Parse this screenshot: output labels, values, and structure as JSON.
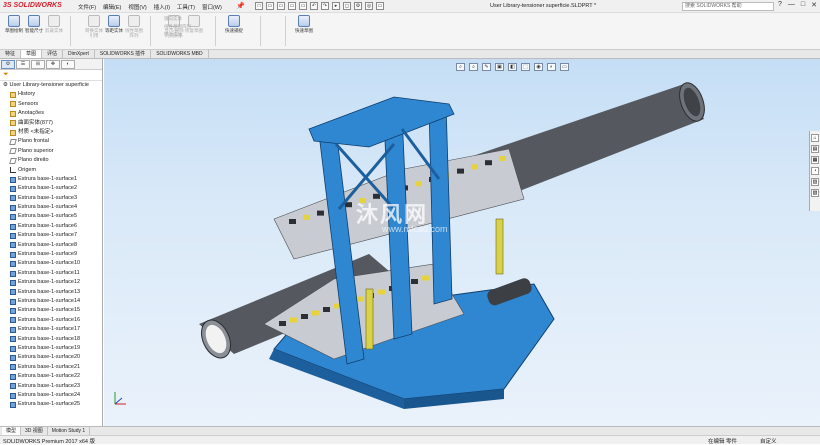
{
  "app": {
    "logo_ds": "3S",
    "logo_text": "SOLIDWORKS"
  },
  "menu": [
    "文件(F)",
    "编辑(E)",
    "视图(V)",
    "插入(I)",
    "工具(T)",
    "窗口(W)"
  ],
  "quick_access": [
    "□",
    "▭",
    "▭",
    "▭",
    "▭",
    "↶",
    "↷",
    "▸",
    "◻",
    "⚙",
    "◎",
    "▭"
  ],
  "window_title": "User Library-tensioner superficie.SLDPRT *",
  "search_placeholder": "搜索 SOLIDWORKS 帮助",
  "window_controls": [
    "?",
    "—",
    "□",
    "✕"
  ],
  "ribbon": {
    "buttons": [
      {
        "label": "草图绘制",
        "dim": false
      },
      {
        "label": "智能尺寸",
        "dim": false
      },
      {
        "label": "剪裁实体",
        "dim": true
      },
      {
        "label": "转换实体引用",
        "dim": true
      },
      {
        "label": "等距实体",
        "dim": false
      },
      {
        "label": "线性草图阵列",
        "dim": true
      },
      {
        "label": "显示/删除几何关系",
        "dim": true
      },
      {
        "label": "修复草图",
        "dim": true
      },
      {
        "label": "快速捕捉",
        "dim": false
      },
      {
        "label": "快速草图",
        "dim": false
      }
    ],
    "mini": [
      "镜向实体",
      "线性草图阵列",
      "移动实体"
    ]
  },
  "command_tabs": [
    {
      "label": "特征",
      "active": false
    },
    {
      "label": "草图",
      "active": true
    },
    {
      "label": "评估",
      "active": false
    },
    {
      "label": "DimXpert",
      "active": false
    },
    {
      "label": "SOLIDWORKS 插件",
      "active": false
    },
    {
      "label": "SOLIDWORKS MBD",
      "active": false
    }
  ],
  "panel_tabs": [
    "⚙",
    "☰",
    "⊞",
    "✥",
    "◐"
  ],
  "filter_icon": "funnel-icon",
  "tree": {
    "root": "User Library-tensioner superficie",
    "items": [
      {
        "label": "History",
        "icon": "folder"
      },
      {
        "label": "Sensors",
        "icon": "folder"
      },
      {
        "label": "Anotações",
        "icon": "folder"
      },
      {
        "label": "曲面实体(877)",
        "icon": "folder"
      },
      {
        "label": "材质 <未指定>",
        "icon": "folder"
      },
      {
        "label": "Plano frontal",
        "icon": "plane"
      },
      {
        "label": "Plano superior",
        "icon": "plane"
      },
      {
        "label": "Plano direito",
        "icon": "plane"
      },
      {
        "label": "Origem",
        "icon": "origin"
      },
      {
        "label": "Estrura base-1-surface1",
        "icon": "body"
      },
      {
        "label": "Estrura base-1-surface2",
        "icon": "body"
      },
      {
        "label": "Estrura base-1-surface3",
        "icon": "body"
      },
      {
        "label": "Estrura base-1-surface4",
        "icon": "body"
      },
      {
        "label": "Estrura base-1-surface5",
        "icon": "body"
      },
      {
        "label": "Estrura base-1-surface6",
        "icon": "body"
      },
      {
        "label": "Estrura base-1-surface7",
        "icon": "body"
      },
      {
        "label": "Estrura base-1-surface8",
        "icon": "body"
      },
      {
        "label": "Estrura base-1-surface9",
        "icon": "body"
      },
      {
        "label": "Estrura base-1-surface10",
        "icon": "body"
      },
      {
        "label": "Estrura base-1-surface11",
        "icon": "body"
      },
      {
        "label": "Estrura base-1-surface12",
        "icon": "body"
      },
      {
        "label": "Estrura base-1-surface13",
        "icon": "body"
      },
      {
        "label": "Estrura base-1-surface14",
        "icon": "body"
      },
      {
        "label": "Estrura base-1-surface15",
        "icon": "body"
      },
      {
        "label": "Estrura base-1-surface16",
        "icon": "body"
      },
      {
        "label": "Estrura base-1-surface17",
        "icon": "body"
      },
      {
        "label": "Estrura base-1-surface18",
        "icon": "body"
      },
      {
        "label": "Estrura base-1-surface19",
        "icon": "body"
      },
      {
        "label": "Estrura base-1-surface20",
        "icon": "body"
      },
      {
        "label": "Estrura base-1-surface21",
        "icon": "body"
      },
      {
        "label": "Estrura base-1-surface22",
        "icon": "body"
      },
      {
        "label": "Estrura base-1-surface23",
        "icon": "body"
      },
      {
        "label": "Estrura base-1-surface24",
        "icon": "body"
      },
      {
        "label": "Estrura base-1-surface25",
        "icon": "body"
      }
    ]
  },
  "heads_up": [
    "⌕",
    "⌕",
    "✎",
    "▣",
    "◧",
    "⬚",
    "◉",
    "◐",
    "▭"
  ],
  "task_pane": [
    "⌂",
    "▤",
    "▦",
    "◔",
    "▥",
    "▧"
  ],
  "watermark": {
    "text": "沐风网",
    "url": "www.mfcad.com"
  },
  "bottom_tabs": [
    {
      "label": "模型",
      "active": true
    },
    {
      "label": "3D 视图",
      "active": false
    },
    {
      "label": "Motion Study 1",
      "active": false
    }
  ],
  "status": {
    "left": "SOLIDWORKS Premium 2017 x64 版",
    "mid": "在编辑 零件",
    "right": "自定义"
  },
  "colors": {
    "frame_blue": "#2f86d1",
    "pipe_dark": "#55595f",
    "viewport_top": "#c5def5"
  }
}
